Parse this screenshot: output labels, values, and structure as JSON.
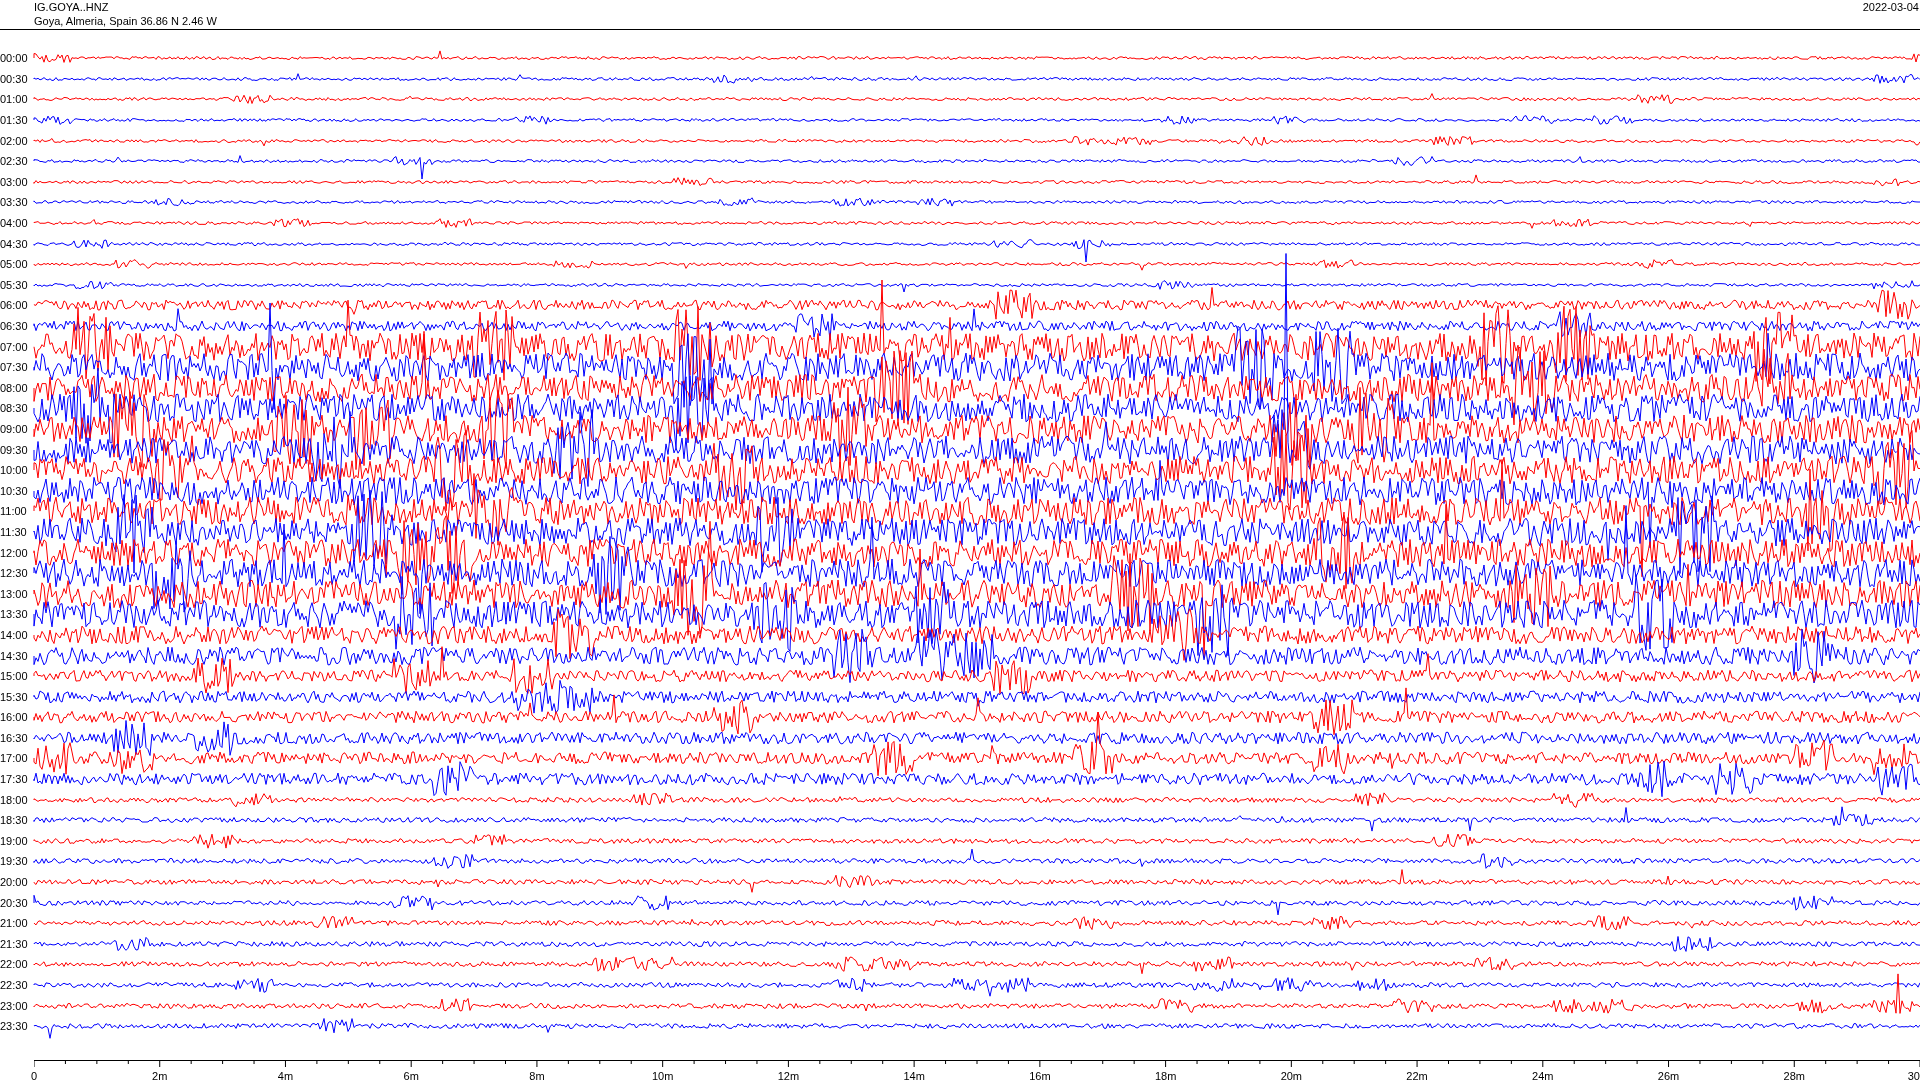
{
  "header": {
    "station": "IG.GOYA..HNZ",
    "location": "Goya, Almeria, Spain  36.86 N 2.46 W",
    "date": "2022-03-04"
  },
  "rows": [
    {
      "time": "00:00",
      "color": "#ff0000"
    },
    {
      "time": "00:30",
      "color": "#0000ff"
    },
    {
      "time": "01:00",
      "color": "#ff0000"
    },
    {
      "time": "01:30",
      "color": "#0000ff"
    },
    {
      "time": "02:00",
      "color": "#ff0000"
    },
    {
      "time": "02:30",
      "color": "#0000ff"
    },
    {
      "time": "03:00",
      "color": "#ff0000"
    },
    {
      "time": "03:30",
      "color": "#0000ff"
    },
    {
      "time": "04:00",
      "color": "#ff0000"
    },
    {
      "time": "04:30",
      "color": "#0000ff"
    },
    {
      "time": "05:00",
      "color": "#ff0000"
    },
    {
      "time": "05:30",
      "color": "#0000ff"
    },
    {
      "time": "06:00",
      "color": "#ff0000"
    },
    {
      "time": "06:30",
      "color": "#0000ff"
    },
    {
      "time": "07:00",
      "color": "#ff0000"
    },
    {
      "time": "07:30",
      "color": "#0000ff"
    },
    {
      "time": "08:00",
      "color": "#ff0000"
    },
    {
      "time": "08:30",
      "color": "#0000ff"
    },
    {
      "time": "09:00",
      "color": "#ff0000"
    },
    {
      "time": "09:30",
      "color": "#0000ff"
    },
    {
      "time": "10:00",
      "color": "#ff0000"
    },
    {
      "time": "10:30",
      "color": "#0000ff"
    },
    {
      "time": "11:00",
      "color": "#ff0000"
    },
    {
      "time": "11:30",
      "color": "#0000ff"
    },
    {
      "time": "12:00",
      "color": "#ff0000"
    },
    {
      "time": "12:30",
      "color": "#0000ff"
    },
    {
      "time": "13:00",
      "color": "#ff0000"
    },
    {
      "time": "13:30",
      "color": "#0000ff"
    },
    {
      "time": "14:00",
      "color": "#ff0000"
    },
    {
      "time": "14:30",
      "color": "#0000ff"
    },
    {
      "time": "15:00",
      "color": "#ff0000"
    },
    {
      "time": "15:30",
      "color": "#0000ff"
    },
    {
      "time": "16:00",
      "color": "#ff0000"
    },
    {
      "time": "16:30",
      "color": "#0000ff"
    },
    {
      "time": "17:00",
      "color": "#ff0000"
    },
    {
      "time": "17:30",
      "color": "#0000ff"
    },
    {
      "time": "18:00",
      "color": "#ff0000"
    },
    {
      "time": "18:30",
      "color": "#0000ff"
    },
    {
      "time": "19:00",
      "color": "#ff0000"
    },
    {
      "time": "19:30",
      "color": "#0000ff"
    },
    {
      "time": "20:00",
      "color": "#ff0000"
    },
    {
      "time": "20:30",
      "color": "#0000ff"
    },
    {
      "time": "21:00",
      "color": "#ff0000"
    },
    {
      "time": "21:30",
      "color": "#0000ff"
    },
    {
      "time": "22:00",
      "color": "#ff0000"
    },
    {
      "time": "22:30",
      "color": "#0000ff"
    },
    {
      "time": "23:00",
      "color": "#ff0000"
    },
    {
      "time": "23:30",
      "color": "#0000ff"
    }
  ],
  "x_axis": {
    "ticks": [
      "0",
      "2m",
      "4m",
      "6m",
      "8m",
      "10m",
      "12m",
      "14m",
      "16m",
      "18m",
      "20m",
      "22m",
      "24m",
      "26m",
      "28m",
      "30"
    ]
  }
}
